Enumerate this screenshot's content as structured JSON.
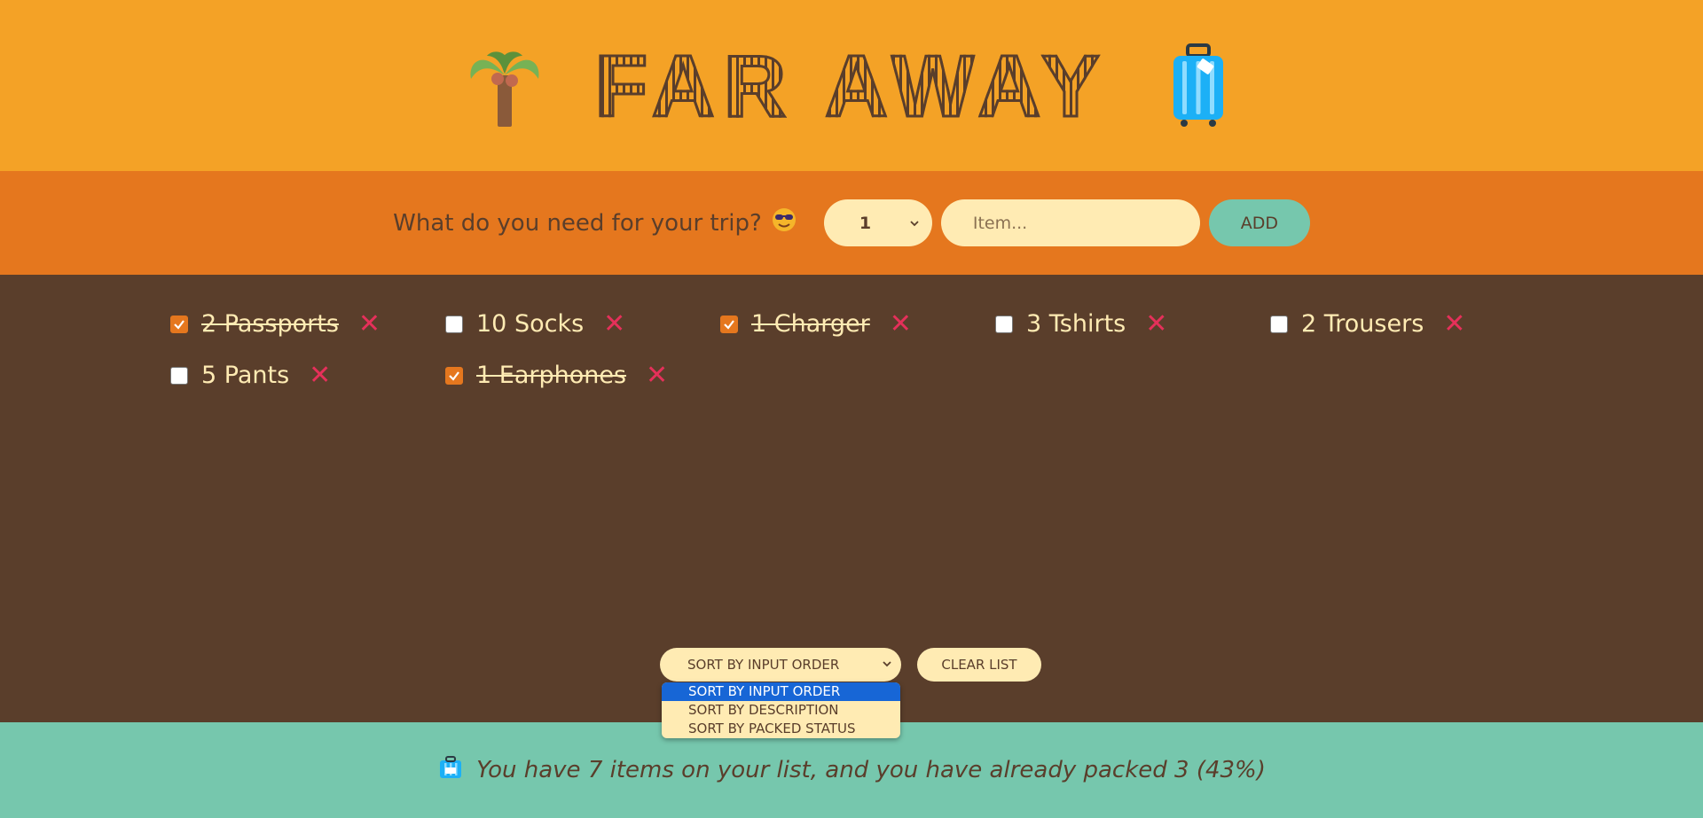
{
  "colors": {
    "header_bg": "#f4a226",
    "form_bg": "#e5771e",
    "list_bg": "#5a3e2b",
    "stats_bg": "#76c7ad",
    "cream": "#ffebb3",
    "delete": "#e5305a",
    "selected_option": "#1766d6"
  },
  "header": {
    "title": "FAR AWAY",
    "left_icon": "palm-tree-icon",
    "right_icon": "luggage-icon"
  },
  "form": {
    "question": "What do you need for your trip?",
    "question_icon": "smiling-sunglasses-icon",
    "quantity_value": "1",
    "item_placeholder": "Item...",
    "add_label": "ADD"
  },
  "items": [
    {
      "label": "2 Passports",
      "packed": true
    },
    {
      "label": "10 Socks",
      "packed": false
    },
    {
      "label": "1 Charger",
      "packed": true
    },
    {
      "label": "3 Tshirts",
      "packed": false
    },
    {
      "label": "2 Trousers",
      "packed": false
    },
    {
      "label": "5 Pants",
      "packed": false
    },
    {
      "label": "1 Earphones",
      "packed": true
    }
  ],
  "actions": {
    "sort_value": "SORT BY INPUT ORDER",
    "sort_options": [
      "SORT BY INPUT ORDER",
      "SORT BY DESCRIPTION",
      "SORT BY PACKED STATUS"
    ],
    "clear_label": "CLEAR LIST"
  },
  "stats": {
    "icon": "luggage-icon",
    "text": "You have 7 items on your list, and you have already packed 3 (43%)"
  }
}
